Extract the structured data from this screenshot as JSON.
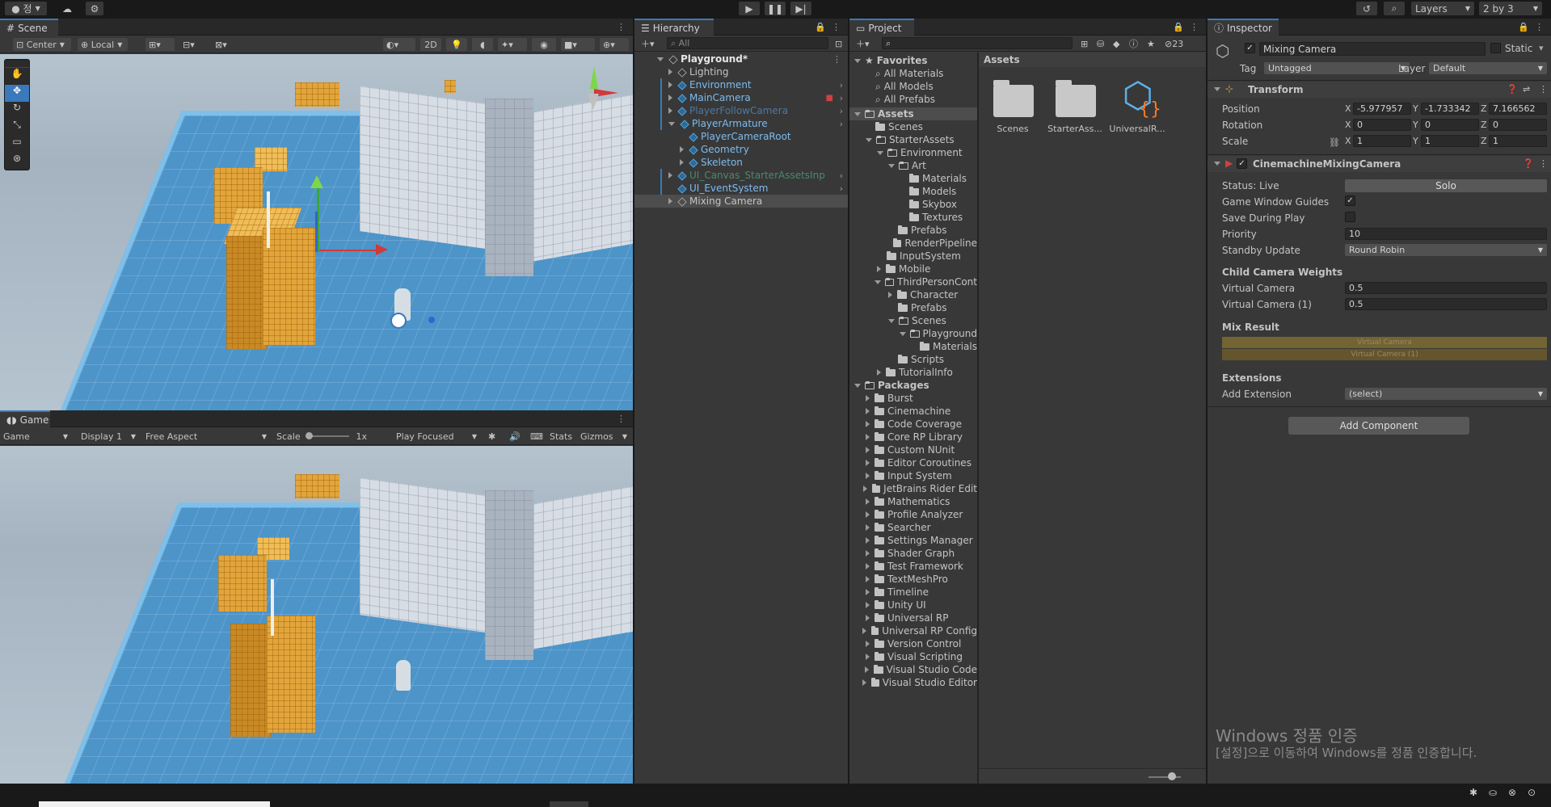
{
  "topbar": {
    "account_label": "정",
    "play_icon": "play-icon",
    "pause_icon": "pause-icon",
    "step_icon": "step-icon",
    "layers_label": "Layers",
    "layout_label": "2 by 3"
  },
  "scene": {
    "tab_label": "Scene",
    "pivot_label": "Center",
    "space_label": "Local",
    "mode_2d": "2D"
  },
  "game": {
    "tab_label": "Game",
    "view_select": "Game",
    "display_select": "Display 1",
    "aspect_select": "Free Aspect",
    "scale_label": "Scale",
    "scale_value": "1x",
    "play_mode_select": "Play Focused",
    "stats_label": "Stats",
    "gizmos_label": "Gizmos"
  },
  "hierarchy": {
    "tab_label": "Hierarchy",
    "search_placeholder": "All",
    "items": [
      {
        "label": "Playground*",
        "color": "#e6e6e6"
      },
      {
        "label": "Lighting",
        "color": "#c4c4c4"
      },
      {
        "label": "Environment",
        "color": "#7cbcf0"
      },
      {
        "label": "MainCamera",
        "color": "#7cbcf0"
      },
      {
        "label": "PlayerFollowCamera",
        "color": "#5077a0"
      },
      {
        "label": "PlayerArmature",
        "color": "#7cbcf0"
      },
      {
        "label": "PlayerCameraRoot",
        "color": "#7cbcf0"
      },
      {
        "label": "Geometry",
        "color": "#7cbcf0"
      },
      {
        "label": "Skeleton",
        "color": "#7cbcf0"
      },
      {
        "label": "UI_Canvas_StarterAssetsInp",
        "color": "#4a8a6a"
      },
      {
        "label": "UI_EventSystem",
        "color": "#7cbcf0"
      },
      {
        "label": "Mixing Camera",
        "color": "#c4c4c4"
      }
    ]
  },
  "project": {
    "tab_label": "Project",
    "hidden_count": "23",
    "favorites_label": "Favorites",
    "favorites": [
      "All Materials",
      "All Models",
      "All Prefabs"
    ],
    "assets_label": "Assets",
    "tree": [
      "Scenes",
      "StarterAssets",
      "Environment",
      "Art",
      "Materials",
      "Models",
      "Skybox",
      "Textures",
      "Prefabs",
      "RenderPipeline",
      "InputSystem",
      "Mobile",
      "ThirdPersonCont",
      "Character",
      "Prefabs",
      "Scenes",
      "Playground",
      "Materials",
      "Scripts",
      "TutorialInfo"
    ],
    "packages_label": "Packages",
    "packages": [
      "Burst",
      "Cinemachine",
      "Code Coverage",
      "Core RP Library",
      "Custom NUnit",
      "Editor Coroutines",
      "Input System",
      "JetBrains Rider Edit",
      "Mathematics",
      "Profile Analyzer",
      "Searcher",
      "Settings Manager",
      "Shader Graph",
      "Test Framework",
      "TextMeshPro",
      "Timeline",
      "Unity UI",
      "Universal RP",
      "Universal RP Config",
      "Version Control",
      "Visual Scripting",
      "Visual Studio Code",
      "Visual Studio Editor"
    ],
    "grid_header": "Assets",
    "grid_items": [
      "Scenes",
      "StarterAss...",
      "UniversalR..."
    ]
  },
  "inspector": {
    "tab_label": "Inspector",
    "object_name": "Mixing Camera",
    "static_label": "Static",
    "tag_label": "Tag",
    "tag_value": "Untagged",
    "layer_label": "Layer",
    "layer_value": "Default",
    "transform": {
      "title": "Transform",
      "position_label": "Position",
      "rotation_label": "Rotation",
      "scale_label": "Scale",
      "x": "X",
      "y": "Y",
      "z": "Z",
      "position": [
        "-5.977957",
        "-1.733342",
        "7.166562"
      ],
      "rotation": [
        "0",
        "0",
        "0"
      ],
      "scale": [
        "1",
        "1",
        "1"
      ]
    },
    "mixing": {
      "title": "CinemachineMixingCamera",
      "status_label": "Status: Live",
      "solo_label": "Solo",
      "guides_label": "Game Window Guides",
      "save_label": "Save During Play",
      "priority_label": "Priority",
      "priority_value": "10",
      "standby_label": "Standby Update",
      "standby_value": "Round Robin",
      "weights_header": "Child Camera Weights",
      "weight_1_label": "Virtual Camera",
      "weight_1_value": "0.5",
      "weight_2_label": "Virtual Camera (1)",
      "weight_2_value": "0.5",
      "mix_header": "Mix Result",
      "mix_bar_1": "Virtual Camera",
      "mix_bar_2": "Virtual Camera (1)",
      "extensions_header": "Extensions",
      "add_extension_label": "Add Extension",
      "add_extension_value": "(select)"
    },
    "add_component": "Add Component",
    "watermark_title": "Windows 정품 인증",
    "watermark_text": "[설정]으로 이동하여 Windows를 정품 인증합니다."
  },
  "colors": {
    "accent": "#3a79bb",
    "prefab_blue": "#7cbcf0",
    "panel": "#383838",
    "field": "#2a2a2a"
  }
}
